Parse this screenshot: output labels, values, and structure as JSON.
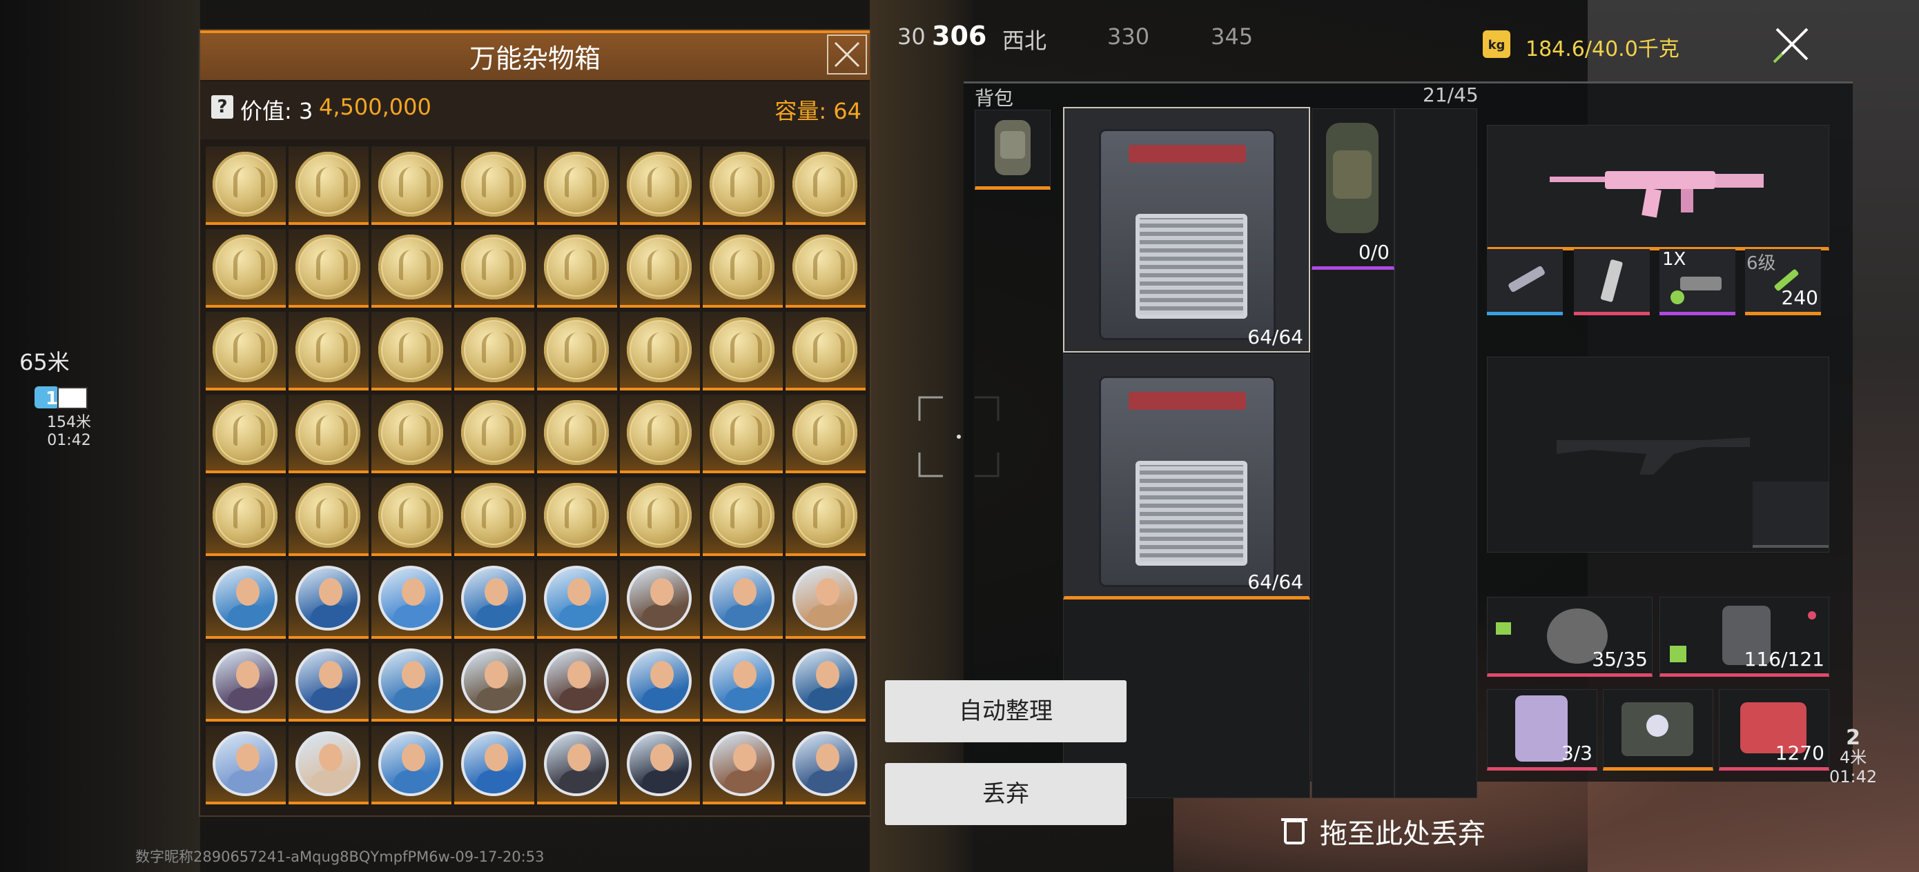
{
  "container": {
    "title": "万能杂物箱",
    "value_label": "价值: 3",
    "value_amount": "4,500,000",
    "capacity_label": "容量: ",
    "capacity_value": "64"
  },
  "grid": {
    "rows": 8,
    "cols": 8,
    "coin_rows": 5,
    "portrait_colors": [
      [
        "#3a7fc0",
        "#2a5ea0",
        "#4a8ad0",
        "#2e6cb0",
        "#3d86c8",
        "#6a5040",
        "#3e7ab8",
        "#c89a70"
      ],
      [
        "#5a4a6a",
        "#2e5a9a",
        "#3a78b8",
        "#6a5a4a",
        "#5a4038",
        "#2a6ab0",
        "#3a7cc0",
        "#2a5a90"
      ],
      [
        "#7a9ad0",
        "#d8c0a8",
        "#3a7ac0",
        "#2a6ab8",
        "#3a3a44",
        "#2a3040",
        "#8a6048",
        "#3a5a8a"
      ]
    ]
  },
  "compass": {
    "items": [
      "30",
      "306",
      "西北",
      "330",
      "345"
    ]
  },
  "left_hud": {
    "distance": "65米",
    "badge": "1",
    "sub_distance": "154米",
    "time": "01:42"
  },
  "inventory": {
    "backpack_title": "背包",
    "backpack_count": "21/45",
    "crate1_count": "64/64",
    "crate2_count": "64/64",
    "pack_item_count": "0/0",
    "weight_icon": "kg",
    "weight": "184.6/40.0千克",
    "scope_label": "1X",
    "grade_label": "6级",
    "ammo_count": "240",
    "helmet_durability": "35/35",
    "armor_durability": "116/121",
    "plate_count": "3/3",
    "medkit_count": "1270"
  },
  "buttons": {
    "auto_sort": "自动整理",
    "discard": "丢弃",
    "drag_discard": "拖至此处丢弃"
  },
  "right_hud": {
    "badge": "2",
    "distance": "4米",
    "time": "01:42"
  },
  "watermark": "数字昵称2890657241-aMqug8BQYmpfPM6w-09-17-20:53",
  "colors": {
    "accent": "#f08c1c",
    "value": "#f5a623",
    "weight": "#f2d34a"
  }
}
